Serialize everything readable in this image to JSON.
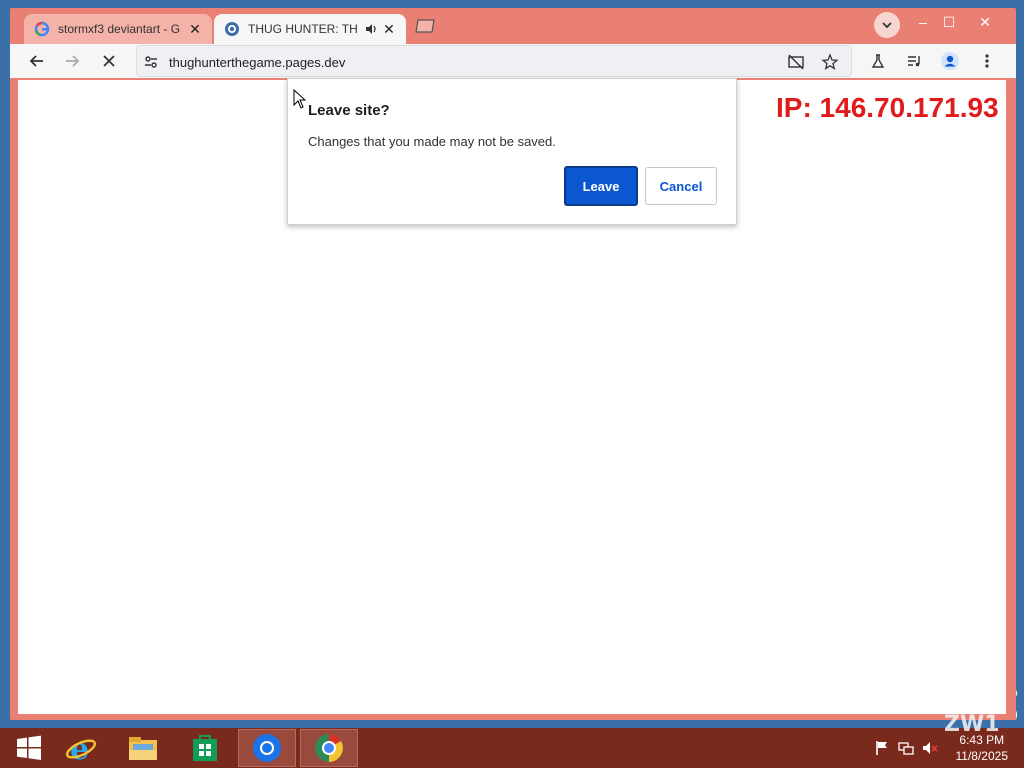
{
  "browser": {
    "tabs": [
      {
        "title": "stormxf3 deviantart - G",
        "favicon": "google-icon",
        "state": "inactive"
      },
      {
        "title": "THUG HUNTER: TH",
        "favicon": "site-globe-icon",
        "state": "active",
        "audio": "speaker-icon"
      }
    ],
    "url": "thughunterthegame.pages.dev",
    "window_controls": {
      "minimize": "–",
      "maximize": "☐",
      "close": "✕"
    },
    "theme_color": "#ea8073"
  },
  "page": {
    "ip_text": "IP: 146.70.171.93"
  },
  "dialog": {
    "title": "Leave site?",
    "message": "Changes that you made may not be saved.",
    "leave_label": "Leave",
    "cancel_label": "Cancel",
    "accent": "#0b57d0"
  },
  "taskbar": {
    "time": "6:43 PM",
    "date": "11/8/2025",
    "items": [
      "windows-start-icon",
      "internet-explorer-icon",
      "file-explorer-icon",
      "store-icon",
      "chrome-icon",
      "chrome-icon"
    ]
  },
  "desktop": {
    "side_texts": [
      "o",
      "000"
    ],
    "watermark": "ZW1"
  }
}
